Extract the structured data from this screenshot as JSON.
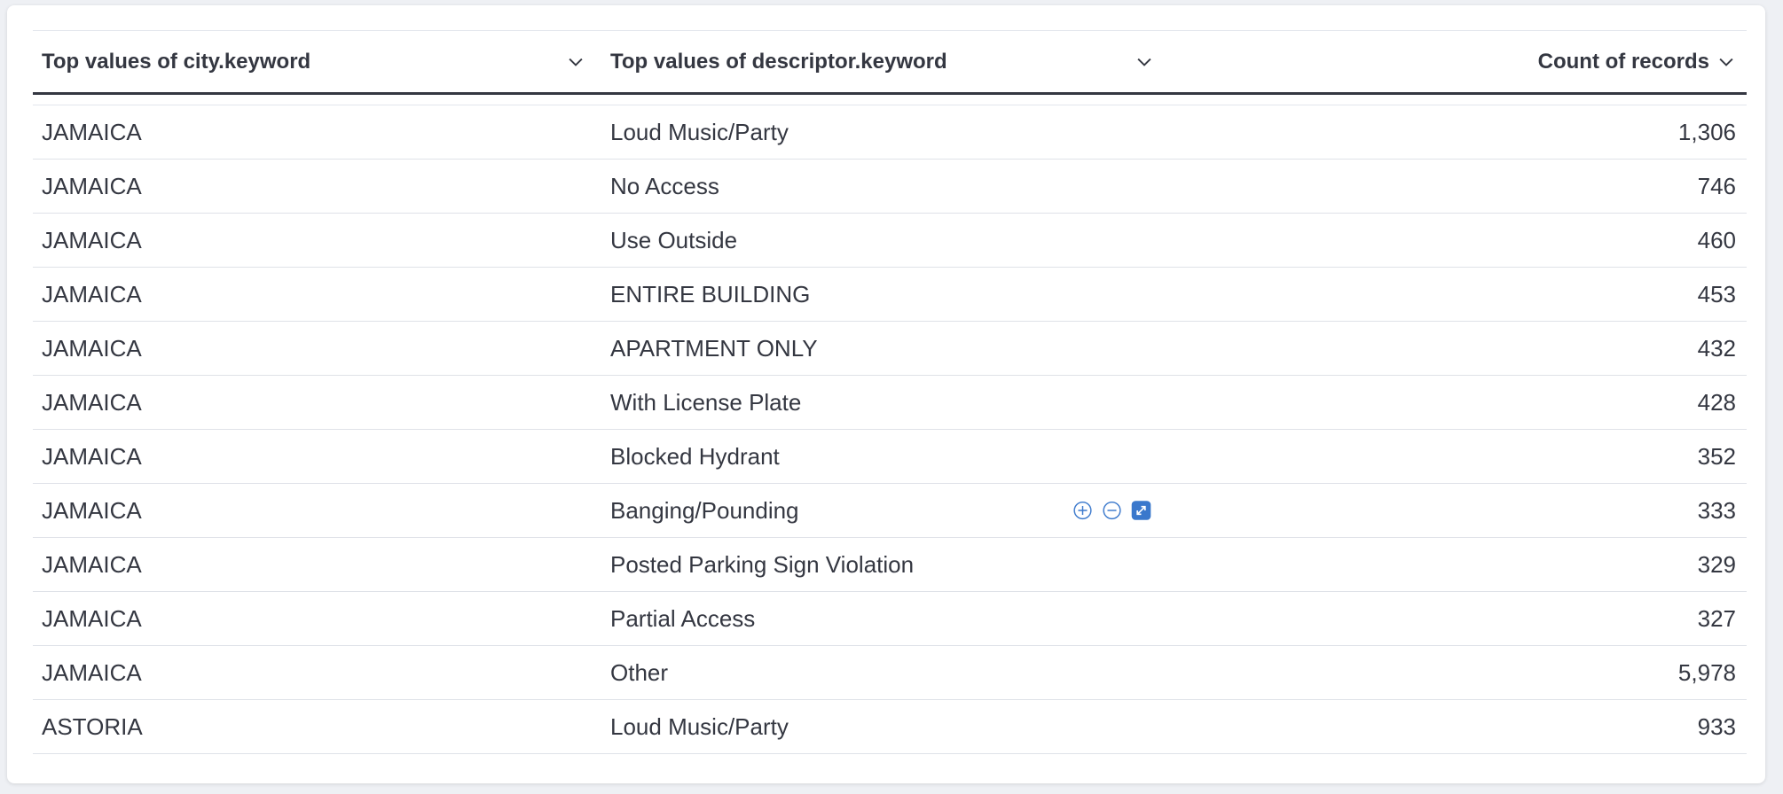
{
  "table": {
    "columns": [
      {
        "label": "Top values of city.keyword",
        "icon": "chevron-down-icon"
      },
      {
        "label": "Top values of descriptor.keyword",
        "icon": "chevron-down-icon"
      },
      {
        "label": "Count of records",
        "icon": "chevron-down-icon"
      }
    ],
    "rows": [
      {
        "city": "JAMAICA",
        "descriptor": "Loud Music/Party",
        "count": "1,306"
      },
      {
        "city": "JAMAICA",
        "descriptor": "No Access",
        "count": "746"
      },
      {
        "city": "JAMAICA",
        "descriptor": "Use Outside",
        "count": "460"
      },
      {
        "city": "JAMAICA",
        "descriptor": "ENTIRE BUILDING",
        "count": "453"
      },
      {
        "city": "JAMAICA",
        "descriptor": "APARTMENT ONLY",
        "count": "432"
      },
      {
        "city": "JAMAICA",
        "descriptor": "With License Plate",
        "count": "428"
      },
      {
        "city": "JAMAICA",
        "descriptor": "Blocked Hydrant",
        "count": "352"
      },
      {
        "city": "JAMAICA",
        "descriptor": "Banging/Pounding",
        "count": "333"
      },
      {
        "city": "JAMAICA",
        "descriptor": "Posted Parking Sign Violation",
        "count": "329"
      },
      {
        "city": "JAMAICA",
        "descriptor": "Partial Access",
        "count": "327"
      },
      {
        "city": "JAMAICA",
        "descriptor": "Other",
        "count": "5,978"
      },
      {
        "city": "ASTORIA",
        "descriptor": "Loud Music/Party",
        "count": "933"
      }
    ],
    "hover_actions": [
      "filter-in-icon",
      "filter-out-icon",
      "expand-icon"
    ]
  },
  "colors": {
    "text": "#343741",
    "accent": "#3a78cc",
    "border": "#dfe2e8"
  }
}
